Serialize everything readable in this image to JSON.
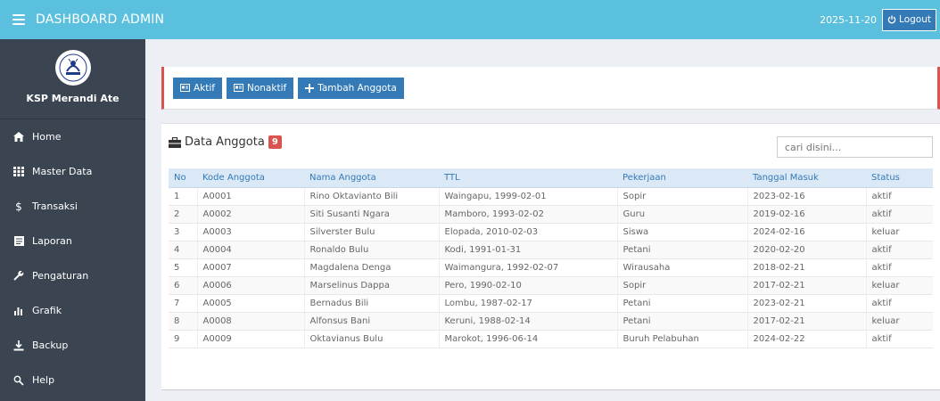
{
  "header": {
    "title": "DASHBOARD ADMIN",
    "date": "2025-11-20",
    "logout_label": "Logout"
  },
  "sidebar": {
    "org_name": "KSP Merandi Ate",
    "items": [
      {
        "label": "Home",
        "icon": "home-icon"
      },
      {
        "label": "Master Data",
        "icon": "grid-icon"
      },
      {
        "label": "Transaksi",
        "icon": "dollar-icon"
      },
      {
        "label": "Laporan",
        "icon": "report-icon"
      },
      {
        "label": "Pengaturan",
        "icon": "wrench-icon"
      },
      {
        "label": "Grafik",
        "icon": "bar-chart-icon"
      },
      {
        "label": "Backup",
        "icon": "download-icon"
      },
      {
        "label": "Help",
        "icon": "help-icon"
      }
    ]
  },
  "toolbar": {
    "aktif_label": "Aktif",
    "nonaktif_label": "Nonaktif",
    "tambah_label": "Tambah Anggota"
  },
  "members": {
    "title": "Data Anggota",
    "count": "9",
    "search_placeholder": "cari disini...",
    "columns": [
      "No",
      "Kode Anggota",
      "Nama Anggota",
      "TTL",
      "Pekerjaan",
      "Tanggal Masuk",
      "Status"
    ],
    "rows": [
      [
        "1",
        "A0001",
        "Rino Oktavianto Bili",
        "Waingapu, 1999-02-01",
        "Sopir",
        "2023-02-16",
        "aktif"
      ],
      [
        "2",
        "A0002",
        "Siti Susanti Ngara",
        "Mamboro, 1993-02-02",
        "Guru",
        "2019-02-16",
        "aktif"
      ],
      [
        "3",
        "A0003",
        "Silverster Bulu",
        "Elopada, 2010-02-03",
        "Siswa",
        "2024-02-16",
        "keluar"
      ],
      [
        "4",
        "A0004",
        "Ronaldo Bulu",
        "Kodi, 1991-01-31",
        "Petani",
        "2020-02-20",
        "aktif"
      ],
      [
        "5",
        "A0007",
        "Magdalena Denga",
        "Waimangura, 1992-02-07",
        "Wirausaha",
        "2018-02-21",
        "aktif"
      ],
      [
        "6",
        "A0006",
        "Marselinus Dappa",
        "Pero, 1990-02-10",
        "Sopir",
        "2017-02-21",
        "keluar"
      ],
      [
        "7",
        "A0005",
        "Bernadus Bili",
        "Lombu, 1987-02-17",
        "Petani",
        "2023-02-21",
        "aktif"
      ],
      [
        "8",
        "A0008",
        "Alfonsus Bani",
        "Keruni, 1988-02-14",
        "Petani",
        "2017-02-21",
        "keluar"
      ],
      [
        "9",
        "A0009",
        "Oktavianus Bulu",
        "Marokot, 1996-06-14",
        "Buruh Pelabuhan",
        "2024-02-22",
        "aktif"
      ]
    ]
  },
  "colors": {
    "header_bg": "#5bc0de",
    "sidebar_bg": "#3a4551",
    "primary": "#337ab7",
    "danger": "#d9534f"
  }
}
